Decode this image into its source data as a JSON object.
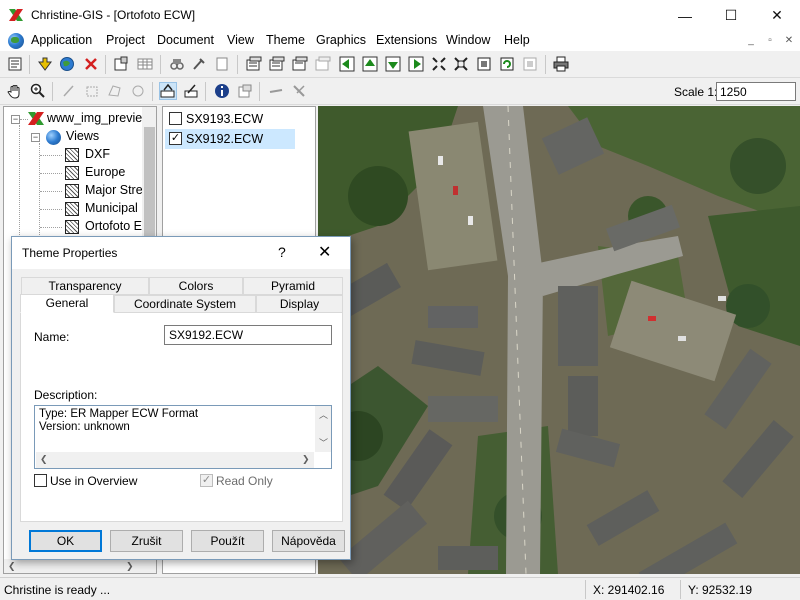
{
  "window": {
    "title": "Christine-GIS - [Ortofoto ECW]",
    "minimize": "—",
    "maximize": "☐",
    "close": "✕"
  },
  "menu": {
    "items": [
      "Application",
      "Project",
      "Document",
      "View",
      "Theme",
      "Graphics",
      "Extensions",
      "Window",
      "Help"
    ],
    "mdi_minimize": "_",
    "mdi_restore": "▫",
    "mdi_close": "✕"
  },
  "toolbar": {
    "scale_label": "Scale 1:",
    "scale_value": "1250"
  },
  "tree": {
    "root_label": "www_img_previe",
    "views_label": "Views",
    "items": [
      "DXF",
      "Europe",
      "Major Stre",
      "Municipal",
      "Ortofoto E"
    ]
  },
  "themes_list": {
    "items": [
      {
        "label": "SX9193.ECW",
        "checked": false
      },
      {
        "label": "SX9192.ECW",
        "checked": true
      }
    ]
  },
  "status": {
    "message": "Christine is ready ...",
    "x": "X: 291402.16",
    "y": "Y: 92532.19"
  },
  "dialog": {
    "title": "Theme Properties",
    "help": "?",
    "close": "✕",
    "tabs_row1": [
      "Transparency",
      "Colors",
      "Pyramid"
    ],
    "tabs_row2": [
      "General",
      "Coordinate System",
      "Display"
    ],
    "name_label": "Name:",
    "name_value": "SX9192.ECW",
    "description_label": "Description:",
    "description_lines": [
      "Type: ER Mapper ECW Format",
      "Version: unknown"
    ],
    "use_in_overview_label": "Use in Overview",
    "use_in_overview_checked": false,
    "read_only_label": "Read Only",
    "read_only_checked": true,
    "buttons": {
      "ok": "OK",
      "cancel": "Zrušit",
      "apply": "Použít",
      "help": "Nápověda"
    }
  }
}
